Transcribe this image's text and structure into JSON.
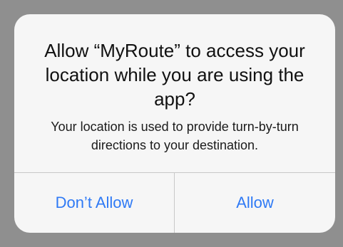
{
  "alert": {
    "title": "Allow “MyRoute” to access your location while you are using the app?",
    "message": "Your location is used to provide turn-by-turn directions to your destination.",
    "buttons": {
      "deny_label": "Don’t Allow",
      "allow_label": "Allow"
    }
  },
  "colors": {
    "backdrop": "#8f8f8f",
    "alert_background": "#f6f6f6",
    "button_text": "#2f7af5",
    "separator": "#c8c8c8"
  }
}
